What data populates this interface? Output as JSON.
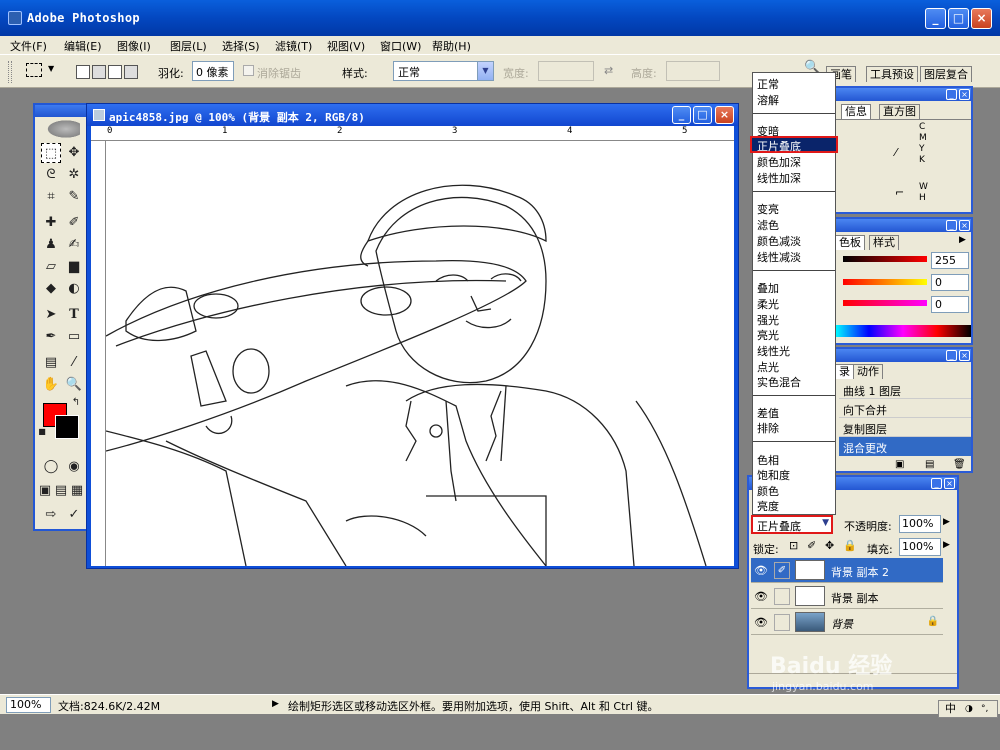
{
  "app": {
    "title": "Adobe Photoshop"
  },
  "menu": [
    "文件(F)",
    "编辑(E)",
    "图像(I)",
    "图层(L)",
    "选择(S)",
    "滤镜(T)",
    "视图(V)",
    "窗口(W)",
    "帮助(H)"
  ],
  "options": {
    "feather_label": "羽化:",
    "feather_value": "0 像素",
    "antialias_label": "消除锯齿",
    "style_label": "样式:",
    "style_value": "正常",
    "width_label": "宽度:",
    "height_label": "高度:"
  },
  "panel_well_tabs": [
    "画笔",
    "工具预设",
    "图层复合"
  ],
  "document": {
    "title": "apic4858.jpg @ 100% (背景 副本 2, RGB/8)",
    "ruler_marks": [
      "0",
      "1",
      "2",
      "3",
      "4",
      "5"
    ],
    "image_caption": "Skater"
  },
  "blend_menu": {
    "groups": [
      [
        "正常",
        "溶解"
      ],
      [
        "变暗",
        "正片叠底",
        "颜色加深",
        "线性加深"
      ],
      [
        "变亮",
        "滤色",
        "颜色减淡",
        "线性减淡"
      ],
      [
        "叠加",
        "柔光",
        "强光",
        "亮光",
        "线性光",
        "点光",
        "实色混合"
      ],
      [
        "差值",
        "排除"
      ],
      [
        "色相",
        "饱和度",
        "颜色",
        "亮度"
      ]
    ],
    "highlighted": "正片叠底"
  },
  "info_panel": {
    "tabs": [
      "信息",
      "直方图"
    ],
    "cmyk": [
      "C",
      "M",
      "Y",
      "K"
    ],
    "wh": [
      "W",
      "H"
    ]
  },
  "color_panel": {
    "tabs": [
      "色板",
      "样式"
    ],
    "values": [
      "255",
      "0",
      "0"
    ],
    "channel_colors": [
      "#ff0000",
      "#ffd800",
      "#e020c0"
    ]
  },
  "history_panel": {
    "tabs": [
      "录",
      "动作"
    ],
    "items": [
      "曲线 1 图层",
      "向下合并",
      "复制图层",
      "混合更改"
    ],
    "active_index": 3
  },
  "layers_panel": {
    "blend_mode": "正片叠底",
    "opacity_label": "不透明度:",
    "opacity_value": "100%",
    "lock_label": "锁定:",
    "fill_label": "填充:",
    "fill_value": "100%",
    "layers": [
      {
        "name": "背景 副本 2",
        "active": true
      },
      {
        "name": "背景 副本",
        "active": false
      },
      {
        "name": "背景",
        "active": false,
        "locked": true
      }
    ]
  },
  "status": {
    "zoom": "100%",
    "doc_info": "文档:824.6K/2.42M",
    "hint": "绘制矩形选区或移动选区外框。要用附加选项，使用 Shift、Alt 和 Ctrl 键。"
  },
  "taskbar": {
    "ime": "中"
  },
  "watermark": {
    "text": "Baidu 经验",
    "sub": "jingyan.baidu.com"
  }
}
